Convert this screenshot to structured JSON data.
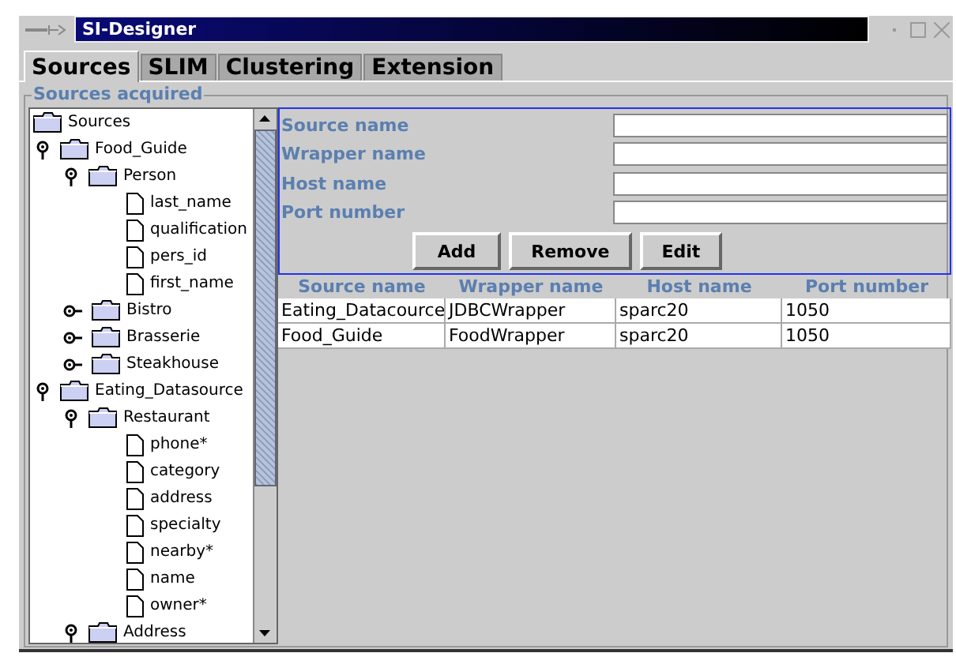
{
  "window": {
    "title": "SI-Designer"
  },
  "tabs": [
    {
      "label": "Sources",
      "selected": true
    },
    {
      "label": "SLIM",
      "selected": false
    },
    {
      "label": "Clustering",
      "selected": false
    },
    {
      "label": "Extension",
      "selected": false
    }
  ],
  "group_title": "Sources acquired",
  "tree": [
    {
      "label": "Sources",
      "kind": "folder",
      "children": [
        {
          "label": "Food_Guide",
          "kind": "folder",
          "expanded": true,
          "children": [
            {
              "label": "Person",
              "kind": "folder",
              "expanded": true,
              "children": [
                {
                  "label": "last_name",
                  "kind": "leaf"
                },
                {
                  "label": "qualification",
                  "kind": "leaf"
                },
                {
                  "label": "pers_id",
                  "kind": "leaf"
                },
                {
                  "label": "first_name",
                  "kind": "leaf"
                }
              ]
            },
            {
              "label": "Bistro",
              "kind": "folder",
              "expanded": false
            },
            {
              "label": "Brasserie",
              "kind": "folder",
              "expanded": false
            },
            {
              "label": "Steakhouse",
              "kind": "folder",
              "expanded": false
            }
          ]
        },
        {
          "label": "Eating_Datasource",
          "kind": "folder",
          "expanded": true,
          "children": [
            {
              "label": "Restaurant",
              "kind": "folder",
              "expanded": true,
              "children": [
                {
                  "label": "phone*",
                  "kind": "leaf"
                },
                {
                  "label": "category",
                  "kind": "leaf"
                },
                {
                  "label": "address",
                  "kind": "leaf"
                },
                {
                  "label": "specialty",
                  "kind": "leaf"
                },
                {
                  "label": "nearby*",
                  "kind": "leaf"
                },
                {
                  "label": "name",
                  "kind": "leaf"
                },
                {
                  "label": "owner*",
                  "kind": "leaf"
                }
              ]
            },
            {
              "label": "Address",
              "kind": "folder",
              "expanded": true
            }
          ]
        }
      ]
    }
  ],
  "form": {
    "fields": [
      {
        "label": "Source name"
      },
      {
        "label": "Wrapper name"
      },
      {
        "label": "Host name"
      },
      {
        "label": "Port number"
      }
    ],
    "buttons": [
      "Add",
      "Remove",
      "Edit"
    ]
  },
  "table": {
    "columns": [
      "Source name",
      "Wrapper name",
      "Host name",
      "Port number"
    ],
    "rows": [
      [
        "Eating_Datacource",
        "JDBCWrapper",
        "sparc20",
        "1050"
      ],
      [
        "Food_Guide",
        "FoodWrapper",
        "sparc20",
        "1050"
      ]
    ]
  }
}
